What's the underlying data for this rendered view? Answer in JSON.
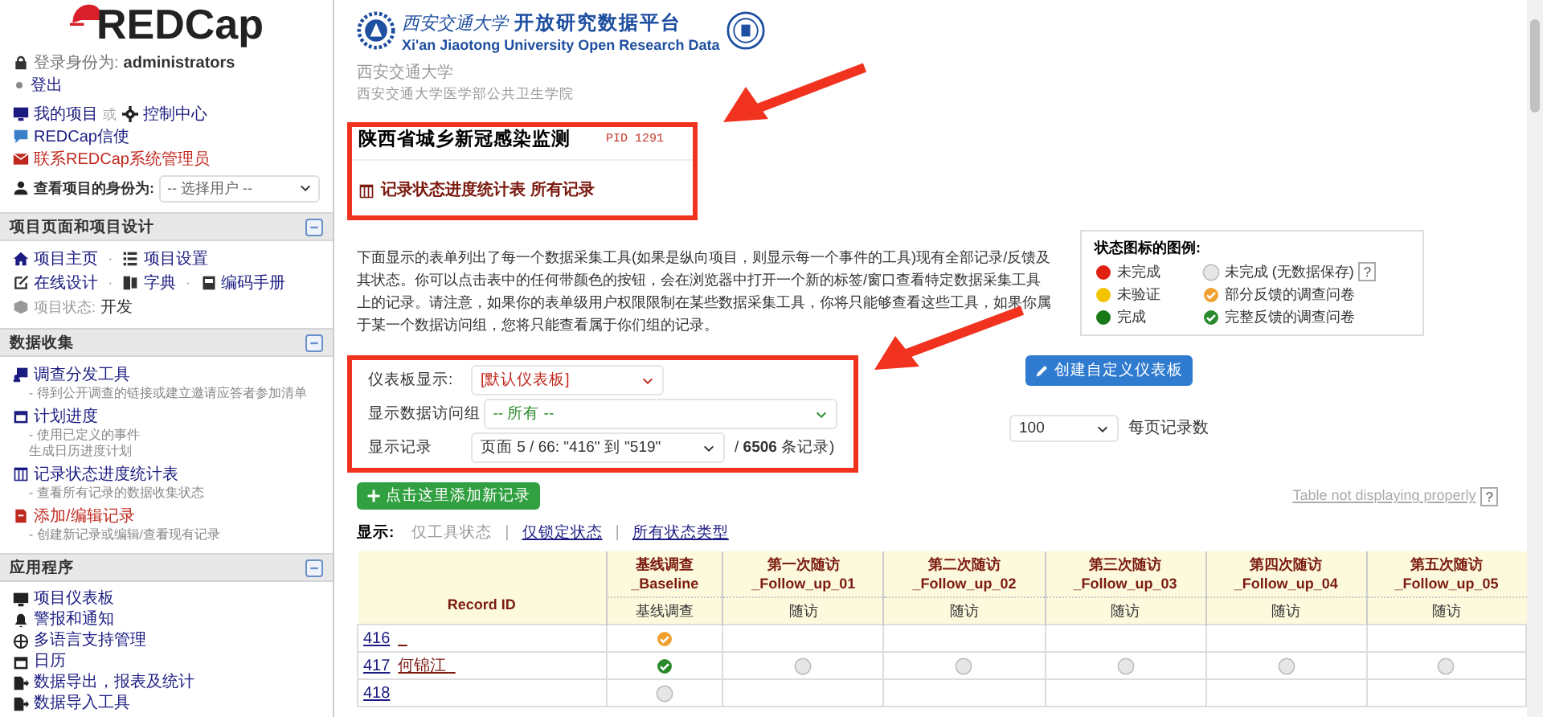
{
  "sidebar": {
    "logo": "REDCap",
    "login_label": "登录身份为:",
    "username": "administrators",
    "logout": "登出",
    "my_projects": "我的项目",
    "or": "或",
    "control_center": "控制中心",
    "messenger": "REDCap信使",
    "contact": "联系REDCap系统管理员",
    "view_as_label": "查看项目的身份为:",
    "view_as_select": "-- 选择用户 --",
    "sections": [
      {
        "kind": "design",
        "title": "项目页面和项目设计",
        "separator": "·",
        "link_rows": [
          [
            {
              "label": "项目主页"
            },
            {
              "label": "项目设置"
            }
          ],
          [
            {
              "label": "在线设计"
            },
            {
              "label": "字典"
            },
            {
              "label": "编码手册"
            }
          ]
        ],
        "status_label": "项目状态:",
        "status_value": "开发"
      },
      {
        "kind": "collection",
        "title": "数据收集",
        "items": [
          {
            "label": "调查分发工具",
            "color": "#1a1a80",
            "notes": [
              "- 得到公开调查的链接或建立邀请应答者参加清单"
            ]
          },
          {
            "label": "计划进度",
            "color": "#1a1a80",
            "notes": [
              "- 使用已定义的事件",
              "生成日历进度计划"
            ]
          },
          {
            "label": "记录状态进度统计表",
            "color": "#1a1a80",
            "notes": [
              "- 查看所有记录的数据收集状态"
            ]
          },
          {
            "label": "添加/编辑记录",
            "color": "#c0271e",
            "notes": [
              "- 创建新记录或编辑/查看现有记录"
            ]
          }
        ]
      },
      {
        "kind": "apps",
        "title": "应用程序",
        "items": [
          {
            "label": "项目仪表板"
          },
          {
            "label": "警报和通知"
          },
          {
            "label": "多语言支持管理"
          },
          {
            "label": "日历"
          },
          {
            "label": "数据导出，报表及统计"
          },
          {
            "label": "数据导入工具"
          }
        ]
      }
    ]
  },
  "main": {
    "brand_cn": "西安交通大学",
    "brand_platform": "开放研究数据平台",
    "brand_en": "Xi'an Jiaotong University Open Research Data",
    "institution": "西安交通大学",
    "department": "西安交通大学医学部公共卫生学院",
    "project_title": "陕西省城乡新冠感染监测",
    "pid": "PID 1291",
    "page_title": "记录状态进度统计表 所有记录",
    "description": "下面显示的表单列出了每一个数据采集工具(如果是纵向项目，则显示每一个事件的工具)现有全部记录/反馈及其状态。你可以点击表中的任何带颜色的按钮，会在浏览器中打开一个新的标签/窗口查看特定数据采集工具上的记录。请注意，如果你的表单级用户权限限制在某些数据采集工具，你将只能够查看这些工具，如果你属于某一个数据访问组，您将只能查看属于你们组的记录。",
    "legend": {
      "title": "状态图标的图例:",
      "help": "?",
      "items": [
        {
          "kind": "incomplete",
          "label": "未完成"
        },
        {
          "kind": "empty",
          "label": "未完成 (无数据保存)"
        },
        {
          "kind": "unverified",
          "label": "未验证"
        },
        {
          "kind": "partial",
          "label": "部分反馈的调查问卷"
        },
        {
          "kind": "complete",
          "label": "完成"
        },
        {
          "kind": "survey_complete",
          "label": "完整反馈的调查问卷"
        }
      ]
    },
    "filters": [
      {
        "label": "仪表板显示:",
        "value": "[默认仪表板]",
        "kind": "dashboard"
      },
      {
        "label": "显示数据访问组",
        "value": "-- 所有 --",
        "kind": "group"
      },
      {
        "label": "显示记录",
        "value": "页面 5 / 66: \"416\" 到 \"519\"",
        "kind": "records",
        "suffix": "/ **6506** 条记录)"
      }
    ],
    "create_dashboard": "创建自定义仪表板",
    "per_page_value": "100",
    "per_page_label": "每页记录数",
    "add_record": "点击这里添加新记录",
    "table_help": "Table not displaying properly",
    "table_help_q": "?",
    "display_label": "显示:",
    "display_separator": "|",
    "display_options": [
      {
        "label": "仅工具状态",
        "selected": true
      },
      {
        "label": "仅锁定状态",
        "selected": false
      },
      {
        "label": "所有状态类型",
        "selected": false
      }
    ],
    "table": {
      "id_header": "Record ID",
      "events": [
        {
          "event": "基线调查",
          "arm": "_Baseline",
          "form": "基线调查"
        },
        {
          "event": "第一次随访",
          "arm": "_Follow_up_01",
          "form": "随访"
        },
        {
          "event": "第二次随访",
          "arm": "_Follow_up_02",
          "form": "随访"
        },
        {
          "event": "第三次随访",
          "arm": "_Follow_up_03",
          "form": "随访"
        },
        {
          "event": "第四次随访",
          "arm": "_Follow_up_04",
          "form": "随访"
        },
        {
          "event": "第五次随访",
          "arm": "_Follow_up_05",
          "form": "随访"
        }
      ],
      "rows": [
        {
          "id": "416",
          "name": "_",
          "cells": [
            {
              "kind": "partial"
            },
            {
              "kind": "none"
            },
            {
              "kind": "none"
            },
            {
              "kind": "none"
            },
            {
              "kind": "none"
            },
            {
              "kind": "none"
            }
          ]
        },
        {
          "id": "417",
          "name": "何锦江_",
          "cells": [
            {
              "kind": "survey_complete"
            },
            {
              "kind": "empty"
            },
            {
              "kind": "empty"
            },
            {
              "kind": "empty"
            },
            {
              "kind": "empty"
            },
            {
              "kind": "empty"
            }
          ]
        },
        {
          "id": "418",
          "cells": [
            {
              "kind": "empty"
            },
            {
              "kind": "none"
            },
            {
              "kind": "none"
            },
            {
              "kind": "none"
            },
            {
              "kind": "none"
            },
            {
              "kind": "none"
            }
          ]
        }
      ]
    }
  }
}
